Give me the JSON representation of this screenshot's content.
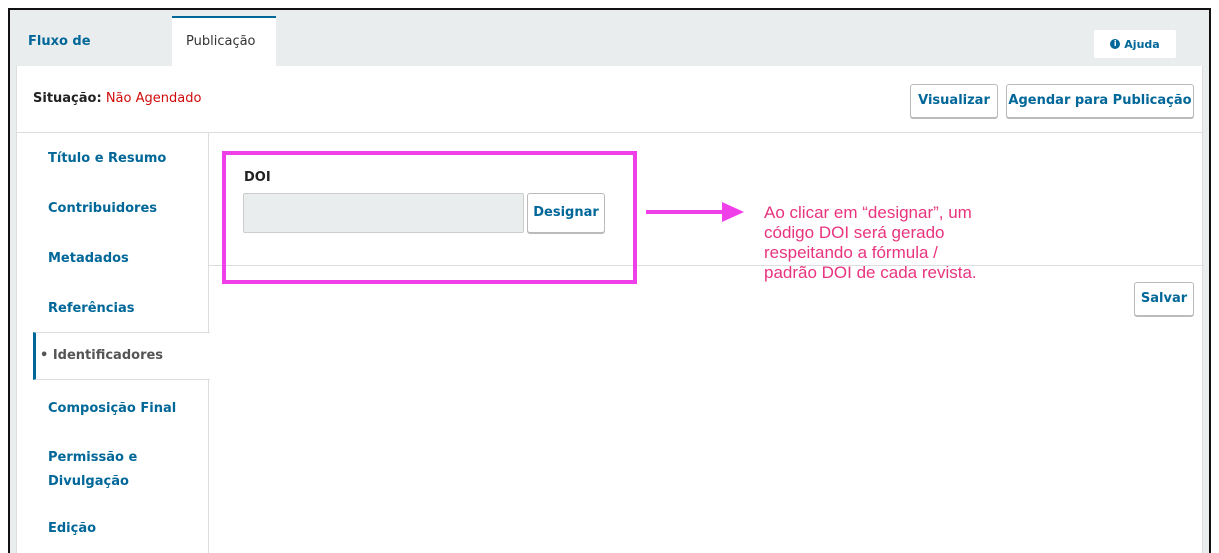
{
  "tabs": [
    {
      "label": "Fluxo de Trabalho"
    },
    {
      "label": "Publicação"
    }
  ],
  "help": {
    "label": "Ajuda",
    "icon": "info-icon"
  },
  "header": {
    "status_label": "Situação:",
    "status_value": "Não Agendado",
    "preview_label": "Visualizar",
    "schedule_label": "Agendar para Publicação"
  },
  "sidebar": {
    "items": [
      {
        "label": "Título e Resumo"
      },
      {
        "label": "Contribuidores"
      },
      {
        "label": "Metadados"
      },
      {
        "label": "Referências"
      },
      {
        "label": "• Identificadores",
        "active": true
      },
      {
        "label": "Composição Final"
      },
      {
        "label": "Permissão e Divulgação"
      },
      {
        "label": "Edição"
      }
    ]
  },
  "form": {
    "doi_label": "DOI",
    "doi_value": "",
    "assign_label": "Designar",
    "save_label": "Salvar"
  },
  "annotation": {
    "text": "Ao clicar em “designar”, um código DOI será gerado respeitando a fórmula / padrão DOI de cada revista.",
    "color": "#e8337f",
    "highlight_color": "#ef3fe9"
  },
  "colors": {
    "accent": "#006798",
    "status_red": "#d00a0a",
    "background": "#eaedee"
  }
}
